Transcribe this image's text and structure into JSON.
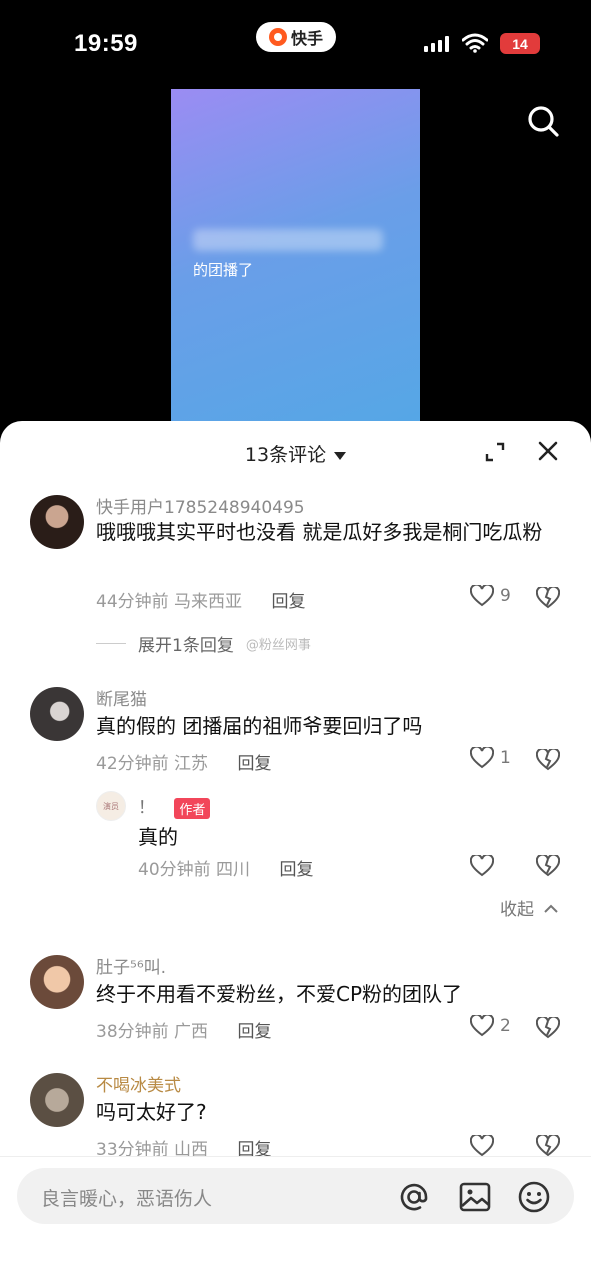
{
  "status_bar": {
    "time": "19:59",
    "app_name": "快手",
    "battery": "14"
  },
  "video": {
    "caption": "的团播了"
  },
  "comments_panel": {
    "count_label": "13条评论",
    "comments": [
      {
        "username": "快手用户1785248940495",
        "text": "哦哦哦其实平时也没看 就是瓜好多我是桐门吃瓜粉",
        "time": "44分钟前",
        "location": "马来西亚",
        "reply_label": "回复",
        "likes": "9",
        "expand_label": "展开1条回复",
        "watermark": "@粉丝网事"
      },
      {
        "username": "断尾猫",
        "text": "真的假的 团播届的祖师爷要回归了吗",
        "time": "42分钟前",
        "location": "江苏",
        "reply_label": "回复",
        "likes": "1",
        "reply": {
          "username": "！",
          "badge": "作者",
          "avatar_text": "演员",
          "text": "真的",
          "time": "40分钟前",
          "location": "四川",
          "reply_label": "回复"
        },
        "collapse_label": "收起"
      },
      {
        "username": "肚子⁵⁶叫.",
        "text": "终于不用看不爱粉丝，不爱CP粉的团队了",
        "time": "38分钟前",
        "location": "广西",
        "reply_label": "回复",
        "likes": "2"
      },
      {
        "username": "不喝冰美式",
        "text": "吗可太好了?",
        "time": "33分钟前",
        "location": "山西",
        "reply_label": "回复"
      }
    ]
  },
  "input": {
    "placeholder": "良言暖心，恶语伤人"
  },
  "colors": {
    "author_badge": "#f2465a",
    "username_gold": "#b88a44",
    "battery_low": "#e23b3b"
  }
}
